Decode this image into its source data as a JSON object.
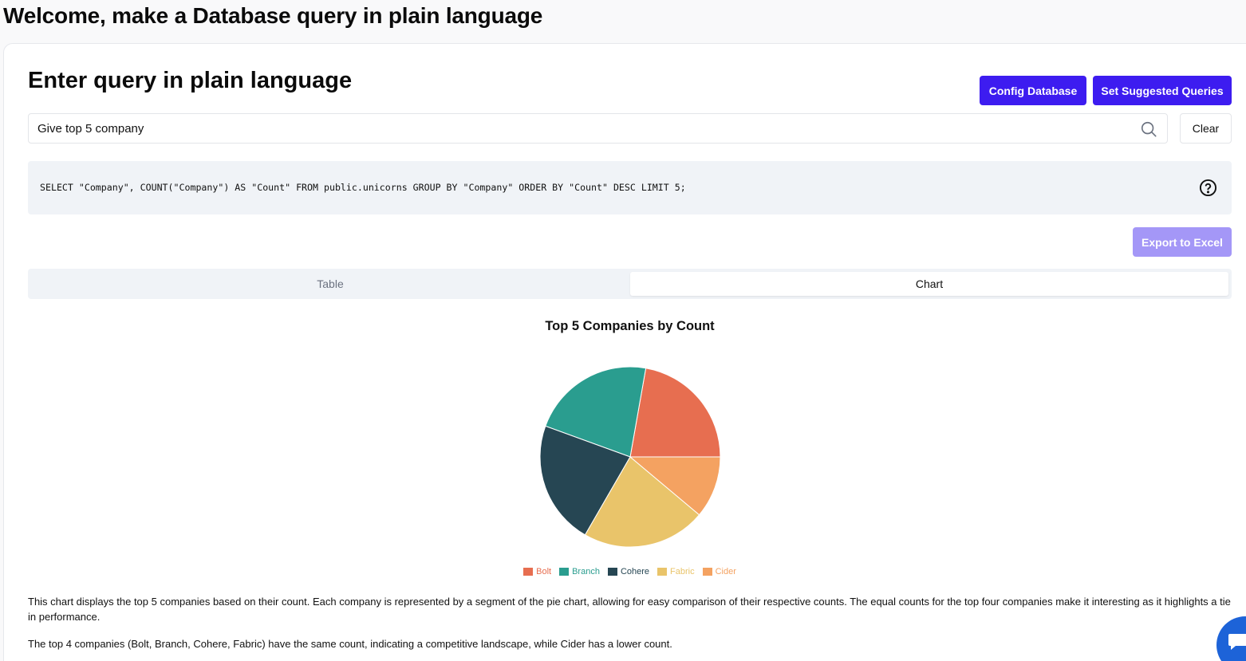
{
  "page": {
    "heading": "Welcome, make a Database query in plain language"
  },
  "query_card": {
    "title": "Enter query in plain language",
    "config_button": "Config Database",
    "suggest_button": "Set Suggested Queries",
    "search": {
      "value": "Give top 5 company",
      "placeholder": ""
    },
    "clear_button": "Clear",
    "sql": "SELECT \"Company\", COUNT(\"Company\") AS \"Count\" FROM public.unicorns GROUP BY \"Company\" ORDER BY \"Count\" DESC LIMIT 5;",
    "export_button": "Export to Excel",
    "tabs": [
      {
        "label": "Table",
        "active": false
      },
      {
        "label": "Chart",
        "active": true
      }
    ]
  },
  "chart_data": {
    "type": "pie",
    "title": "Top 5 Companies by Count",
    "categories": [
      "Bolt",
      "Branch",
      "Cohere",
      "Fabric",
      "Cider"
    ],
    "values": [
      2,
      2,
      2,
      2,
      1
    ],
    "colors": [
      "#e76e50",
      "#2a9d8f",
      "#264653",
      "#e9c46a",
      "#f4a261"
    ],
    "legend": "bottom"
  },
  "description": {
    "paragraph_1": "This chart displays the top 5 companies based on their count. Each company is represented by a segment of the pie chart, allowing for easy comparison of their respective counts. The equal counts for the top four companies make it interesting as it highlights a tie in performance.",
    "paragraph_2": "The top 4 companies (Bolt, Branch, Cohere, Fabric) have the same count, indicating a competitive landscape, while Cider has a lower count."
  },
  "colors": {
    "primary": "#3d1cf0",
    "primary_disabled": "#a497f7",
    "chat_bubble": "#1d63d8"
  }
}
